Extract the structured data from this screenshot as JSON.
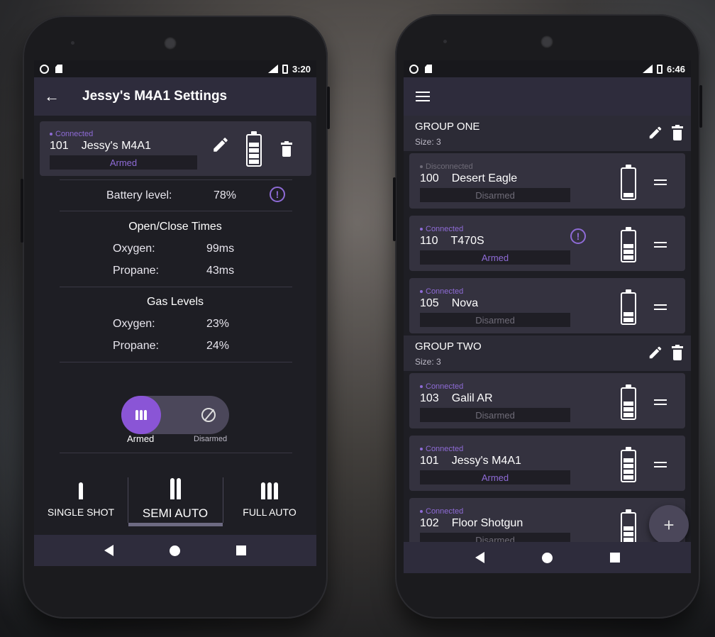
{
  "left_phone": {
    "status_bar": {
      "time": "3:20"
    },
    "appbar": {
      "title": "Jessy's M4A1 Settings"
    },
    "device": {
      "status": "Connected",
      "id": "101",
      "name": "Jessy's M4A1",
      "arm_state": "Armed",
      "battery_level_fraction": 0.78
    },
    "battery": {
      "label": "Battery level:",
      "value": "78%"
    },
    "open_close": {
      "title": "Open/Close Times",
      "oxygen_label": "Oxygen:",
      "oxygen_value": "99ms",
      "propane_label": "Propane:",
      "propane_value": "43ms"
    },
    "gas_levels": {
      "title": "Gas Levels",
      "oxygen_label": "Oxygen:",
      "oxygen_value": "23%",
      "propane_label": "Propane:",
      "propane_value": "24%"
    },
    "toggle": {
      "armed_label": "Armed",
      "disarmed_label": "Disarmed",
      "state": "armed"
    },
    "fire_modes": [
      {
        "label": "SINGLE SHOT",
        "selected": false
      },
      {
        "label": "SEMI AUTO",
        "selected": true
      },
      {
        "label": "FULL AUTO",
        "selected": false
      }
    ]
  },
  "right_phone": {
    "status_bar": {
      "time": "6:46"
    },
    "groups": [
      {
        "name": "GROUP ONE",
        "size": "Size: 3",
        "items": [
          {
            "status": "Disconnected",
            "id": "100",
            "name": "Desert Eagle",
            "arm_state": "Disarmed",
            "battery_level_fraction": 0.2,
            "alert": false
          },
          {
            "status": "Connected",
            "id": "110",
            "name": "T470S",
            "arm_state": "Armed",
            "battery_level_fraction": 0.6,
            "alert": true
          },
          {
            "status": "Connected",
            "id": "105",
            "name": "Nova",
            "arm_state": "Disarmed",
            "battery_level_fraction": 0.4,
            "alert": false
          }
        ]
      },
      {
        "name": "GROUP TWO",
        "size": "Size: 3",
        "items": [
          {
            "status": "Connected",
            "id": "103",
            "name": "Galil AR",
            "arm_state": "Disarmed",
            "battery_level_fraction": 0.6,
            "alert": false
          },
          {
            "status": "Connected",
            "id": "101",
            "name": "Jessy's M4A1",
            "arm_state": "Armed",
            "battery_level_fraction": 0.8,
            "alert": false
          },
          {
            "status": "Connected",
            "id": "102",
            "name": "Floor Shotgun",
            "arm_state": "Disarmed",
            "battery_level_fraction": 0.6,
            "alert": false
          }
        ]
      }
    ],
    "fab_label": "+"
  },
  "colors": {
    "accent": "#8a55d6",
    "surface": "#34323f",
    "appbar": "#2e2c3c",
    "background": "#1e1e24"
  }
}
